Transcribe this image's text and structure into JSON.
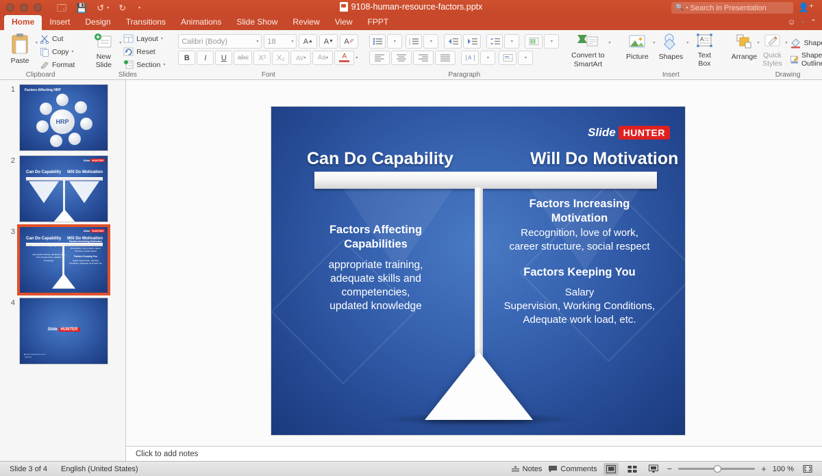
{
  "titlebar": {
    "filename": "9108-human-resource-factors.pptx",
    "icons": [
      "sidebar-toggle-icon",
      "save-icon",
      "undo-icon",
      "redo-icon",
      "customize-icon"
    ],
    "search_placeholder": "Search in Presentation",
    "share_icon": "person-add-icon"
  },
  "tabs": [
    {
      "label": "Home",
      "active": true
    },
    {
      "label": "Insert",
      "active": false
    },
    {
      "label": "Design",
      "active": false
    },
    {
      "label": "Transitions",
      "active": false
    },
    {
      "label": "Animations",
      "active": false
    },
    {
      "label": "Slide Show",
      "active": false
    },
    {
      "label": "Review",
      "active": false
    },
    {
      "label": "View",
      "active": false
    },
    {
      "label": "FPPT",
      "active": false
    }
  ],
  "tabbar_right": {
    "smiley": "smiley-icon",
    "collapse": "chevron-up-icon"
  },
  "ribbon": {
    "clipboard": {
      "group_label": "Clipboard",
      "paste": "Paste",
      "cut": "Cut",
      "copy": "Copy",
      "format": "Format"
    },
    "slides": {
      "group_label": "Slides",
      "new_slide": "New\nSlide",
      "new_slide_line1": "New",
      "new_slide_line2": "Slide",
      "layout": "Layout",
      "reset": "Reset",
      "section": "Section"
    },
    "font": {
      "group_label": "Font",
      "font_name": "Calibri (Body)",
      "font_size": "18",
      "grow": "A",
      "shrink": "A",
      "clear_formatting": "A",
      "bold": "B",
      "italic": "I",
      "underline": "U",
      "strikethrough": "abc",
      "superscript": "X²",
      "subscript": "X₂",
      "character_spacing": "AV",
      "change_case": "Aa",
      "font_color": "A"
    },
    "paragraph": {
      "group_label": "Paragraph",
      "bullets": "bullets-icon",
      "numbering": "numbering-icon",
      "decrease_indent": "decrease-indent-icon",
      "increase_indent": "increase-indent-icon",
      "line_spacing": "line-spacing-icon",
      "columns": "columns-icon",
      "align_left": "align-left-icon",
      "align_center": "align-center-icon",
      "align_right": "align-right-icon",
      "justify": "justify-icon",
      "text_direction": "text-direction-icon",
      "align_text": "align-text-icon",
      "convert_to_smartart_line1": "Convert to",
      "convert_to_smartart_line2": "SmartArt"
    },
    "insert": {
      "group_label": "Insert",
      "picture": "Picture",
      "shapes": "Shapes",
      "text_box_line1": "Text",
      "text_box_line2": "Box"
    },
    "drawing": {
      "group_label": "Drawing",
      "arrange": "Arrange",
      "quick_styles_line1": "Quick",
      "quick_styles_line2": "Styles",
      "shape_fill": "Shape Fill",
      "shape_outline": "Shape Outline"
    }
  },
  "thumbnails": [
    {
      "number": "1",
      "selected": false,
      "title": "Factors Affecting HRP",
      "center": "HRP"
    },
    {
      "number": "2",
      "selected": false,
      "left": "Can Do Capability",
      "right": "Will Do Motivation"
    },
    {
      "number": "3",
      "selected": true,
      "left": "Can Do Capability",
      "right": "Will Do Motivation"
    },
    {
      "number": "4",
      "selected": false,
      "logo": "Slide HUNTER"
    }
  ],
  "slide": {
    "logo_word": "Slide",
    "logo_brand": "HUNTER",
    "heading_left": "Can Do Capability",
    "heading_right": "Will Do Motivation",
    "left_title_line1": "Factors Affecting",
    "left_title_line2": "Capabilities",
    "left_body_line1": "appropriate training,",
    "left_body_line2": "adequate skills and",
    "left_body_line3": "competencies,",
    "left_body_line4": "updated knowledge",
    "right_title1_line1": "Factors Increasing",
    "right_title1_line2": "Motivation",
    "right_body1_line1": "Recognition, love of work,",
    "right_body1_line2": "career structure, social respect",
    "right_title2": "Factors Keeping You",
    "right_body2_line1": "Salary",
    "right_body2_line2": "Supervision, Working Conditions,",
    "right_body2_line3": "Adequate work load, etc."
  },
  "notes": {
    "placeholder": "Click to add notes"
  },
  "status": {
    "slide_count": "Slide 3 of 4",
    "language": "English (United States)",
    "notes": "Notes",
    "comments": "Comments",
    "zoom_minus": "−",
    "zoom_plus": "+",
    "zoom_level": "100 %",
    "fit_icon": "fit-slide-icon",
    "view_normal": "normal-view-icon",
    "view_sorter": "slide-sorter-icon",
    "view_show": "slide-show-icon"
  },
  "colors": {
    "titlebar": "#c7482a",
    "accent_red": "#e02020",
    "slide_blue_light": "#4a7ac4",
    "slide_blue_dark": "#1b3a7d",
    "selection": "#e0502a"
  }
}
